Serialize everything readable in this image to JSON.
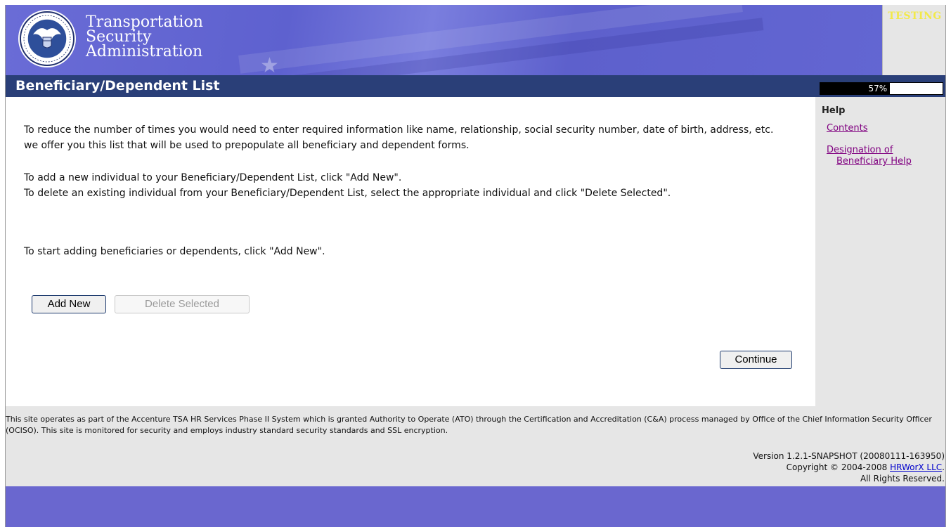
{
  "header": {
    "brand_line1": "Transportation",
    "brand_line2": "Security",
    "brand_line3": "Administration",
    "environment_badge": "TESTING"
  },
  "page": {
    "title": "Beneficiary/Dependent List",
    "progress_label": "57%",
    "progress_value": 0.57
  },
  "help": {
    "heading": "Help",
    "links": [
      {
        "label": "Contents"
      },
      {
        "label_line1": "Designation of",
        "label_line2": "Beneficiary Help"
      }
    ]
  },
  "content": {
    "intro": "To reduce the number of times you would need to enter required information like name, relationship, social security number, date of birth, address, etc. we offer you this list that will be used to prepopulate all beneficiary and dependent forms.",
    "add_instruction": "To add a new individual to your Beneficiary/Dependent List, click \"Add New\".",
    "delete_instruction": "To delete an existing individual from your Beneficiary/Dependent List, select the appropriate individual and click \"Delete Selected\".",
    "start_instruction": "To start adding beneficiaries or dependents, click \"Add New\"."
  },
  "buttons": {
    "add_new": "Add New",
    "delete_selected": "Delete Selected",
    "continue": "Continue"
  },
  "footer": {
    "notice": "This site operates as part of the Accenture TSA HR Services Phase II System which is granted Authority to Operate (ATO) through the Certification and Accreditation (C&A) process managed by Office of the Chief Information Security Officer (OCISO). This site is monitored for security and employs industry standard security standards and SSL encryption.",
    "version": "Version 1.2.1-SNAPSHOT (20080111-163950)",
    "copyright_prefix": "Copyright © 2004-2008 ",
    "copyright_link": "HRWorX LLC",
    "copyright_suffix": ".",
    "rights": "All Rights Reserved."
  },
  "colors": {
    "banner": "#6467d3",
    "title_bar": "#2a3f78",
    "help_panel": "#e6e6e6",
    "badge_text": "#f2e94a",
    "visited_link": "#800080"
  }
}
